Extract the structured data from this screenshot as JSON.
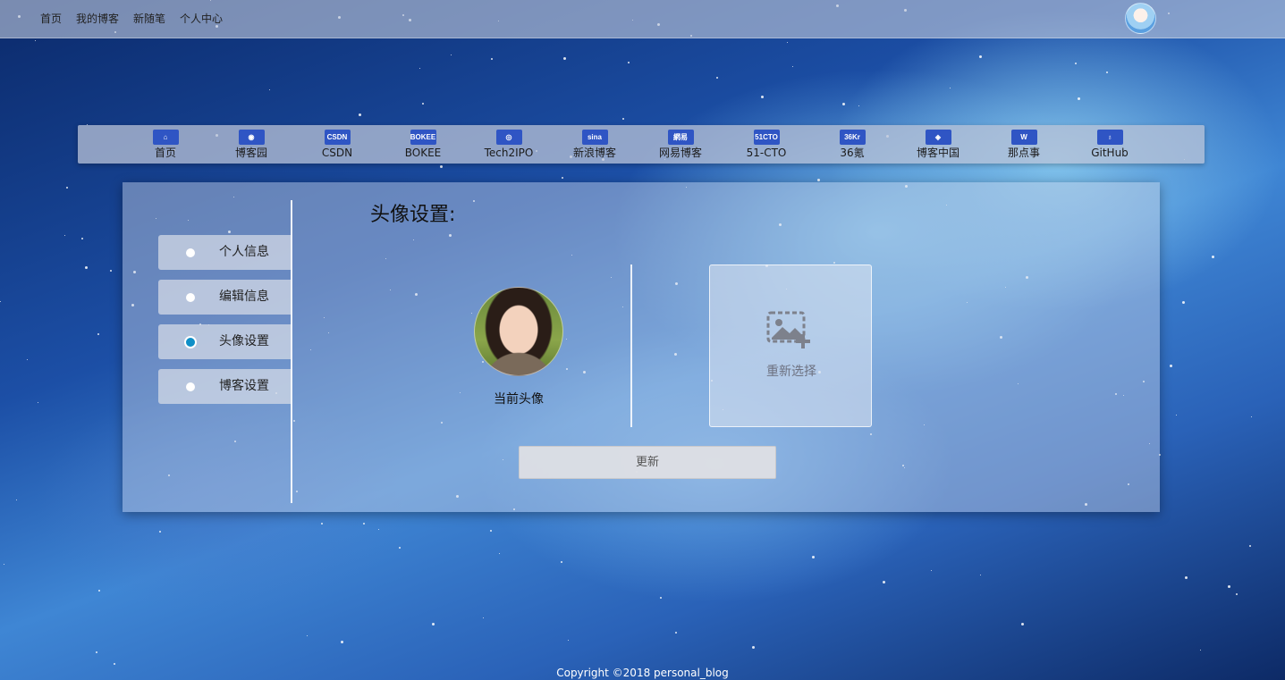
{
  "topnav": {
    "items": [
      "首页",
      "我的博客",
      "新随笔",
      "个人中心"
    ]
  },
  "links": [
    {
      "label": "首页",
      "icon": "home-icon",
      "glyph": "⌂"
    },
    {
      "label": "博客园",
      "icon": "rss-icon",
      "glyph": "◉"
    },
    {
      "label": "CSDN",
      "icon": "csdn-logo-icon",
      "glyph": "CSDN"
    },
    {
      "label": "BOKEE",
      "icon": "bokee-logo-icon",
      "glyph": "BOKEE"
    },
    {
      "label": "Tech2IPO",
      "icon": "tech2ipo-logo-icon",
      "glyph": "◎"
    },
    {
      "label": "新浪博客",
      "icon": "sina-logo-icon",
      "glyph": "sina"
    },
    {
      "label": "网易博客",
      "icon": "netease-logo-icon",
      "glyph": "網易"
    },
    {
      "label": "51-CTO",
      "icon": "51cto-logo-icon",
      "glyph": "51CTO"
    },
    {
      "label": "36氪",
      "icon": "36kr-logo-icon",
      "glyph": "36Kr"
    },
    {
      "label": "博客中国",
      "icon": "blogchina-logo-icon",
      "glyph": "◈"
    },
    {
      "label": "那点事",
      "icon": "nadianshi-logo-icon",
      "glyph": "W"
    },
    {
      "label": "GitHub",
      "icon": "github-icon",
      "glyph": "♁"
    }
  ],
  "sidebar": {
    "items": [
      {
        "label": "个人信息",
        "active": false
      },
      {
        "label": "编辑信息",
        "active": false
      },
      {
        "label": "头像设置",
        "active": true
      },
      {
        "label": "博客设置",
        "active": false
      }
    ]
  },
  "avatar_settings": {
    "title": "头像设置:",
    "current_label": "当前头像",
    "reselect_label": "重新选择",
    "update_button": "更新"
  },
  "colors": {
    "link_icon_bg": "#2f55c4",
    "active_dot": "#0f8fc7"
  },
  "footer": {
    "copyright": "Copyright ©2018 personal_blog"
  }
}
